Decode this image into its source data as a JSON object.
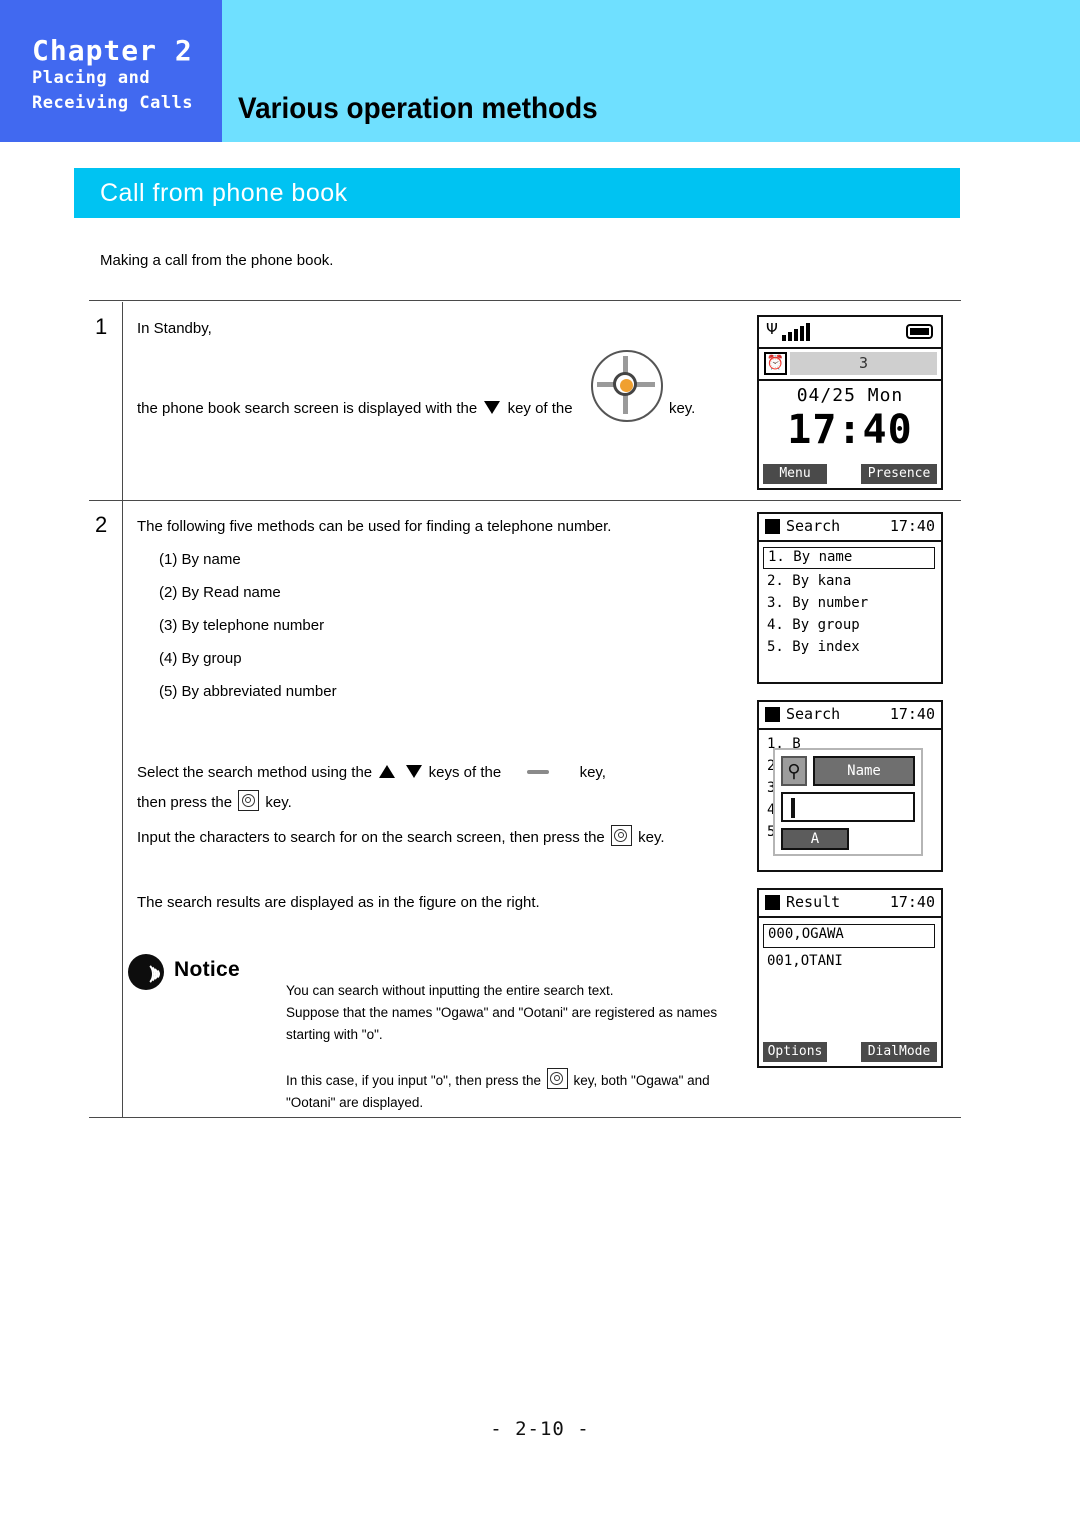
{
  "header": {
    "chapter_title": "Chapter 2",
    "chapter_sub_line1": "Placing and",
    "chapter_sub_line2": "Receiving Calls",
    "main_title": "Various operation methods",
    "chapter_box_color": "#4169f0",
    "banner_color": "#6fe0ff"
  },
  "section": {
    "title": "Call from phone book",
    "bar_color": "#00c3f2"
  },
  "intro": {
    "text": "Making a call from the phone book."
  },
  "steps": [
    {
      "number": "1",
      "line1": "In Standby,",
      "line2_before_tri": "the phone book search screen is displayed with the",
      "line2_mid": "key of the",
      "line2_after_navkey": "key."
    },
    {
      "number": "2",
      "intro": "The following five methods can be used for finding a telephone number.",
      "methods": [
        "(1) By name",
        "(2) By Read name",
        "(3) By telephone number",
        "(4) By group",
        "(5) By abbreviated number"
      ],
      "select_line_a": "Select the search method using the",
      "select_line_b": "keys of the",
      "select_line_c": "key,",
      "select_line_d": "then press the",
      "select_line_e": "key.",
      "input_line_a": "Input the characters to search for on the search screen,  then press the",
      "input_line_b": "key.",
      "result_line": "The search results are displayed as in the figure on the right."
    }
  ],
  "screens": {
    "standby": {
      "signal_icon": "signal-bars-icon",
      "battery_icon": "battery-icon",
      "alarm_icon": "alarm-clock-icon",
      "count": "3",
      "date": "04/25 Mon",
      "time": "17:40",
      "softkey_left": "Menu",
      "softkey_right": "Presence"
    },
    "search_menu": {
      "title": "Search",
      "time": "17:40",
      "items": [
        "1. By name",
        "2. By kana",
        "3. By number",
        "4. By group",
        "5. By index"
      ],
      "selected_index": 0
    },
    "search_input": {
      "title": "Search",
      "time": "17:40",
      "background_items": [
        "1. B",
        "2.",
        "3.",
        "4.",
        "5."
      ],
      "magnifier_icon": "magnifier-icon",
      "field_label": "Name",
      "field_value": "",
      "input_mode": "A"
    },
    "result": {
      "title": "Result",
      "time": "17:40",
      "items": [
        "000,OGAWA",
        "001,OTANI"
      ],
      "selected_index": 0,
      "softkey_left": "Options",
      "softkey_right": "DialMode"
    }
  },
  "notice": {
    "icon": "notice-speaker-icon",
    "label": "Notice",
    "paragraph1_line1": "You can search without inputting the entire search text.",
    "paragraph1_line2": "Suppose that the names \"Ogawa\" and \"Ootani\" are registered as names",
    "paragraph1_line3": "starting with \"o\".",
    "paragraph2_before_key": "In this case, if you input \"o\", then press the",
    "paragraph2_after_key": "key, both \"Ogawa\" and",
    "paragraph2_line2": "\"Ootani\" are displayed."
  },
  "footer": {
    "page_number": "- 2-10 -"
  }
}
